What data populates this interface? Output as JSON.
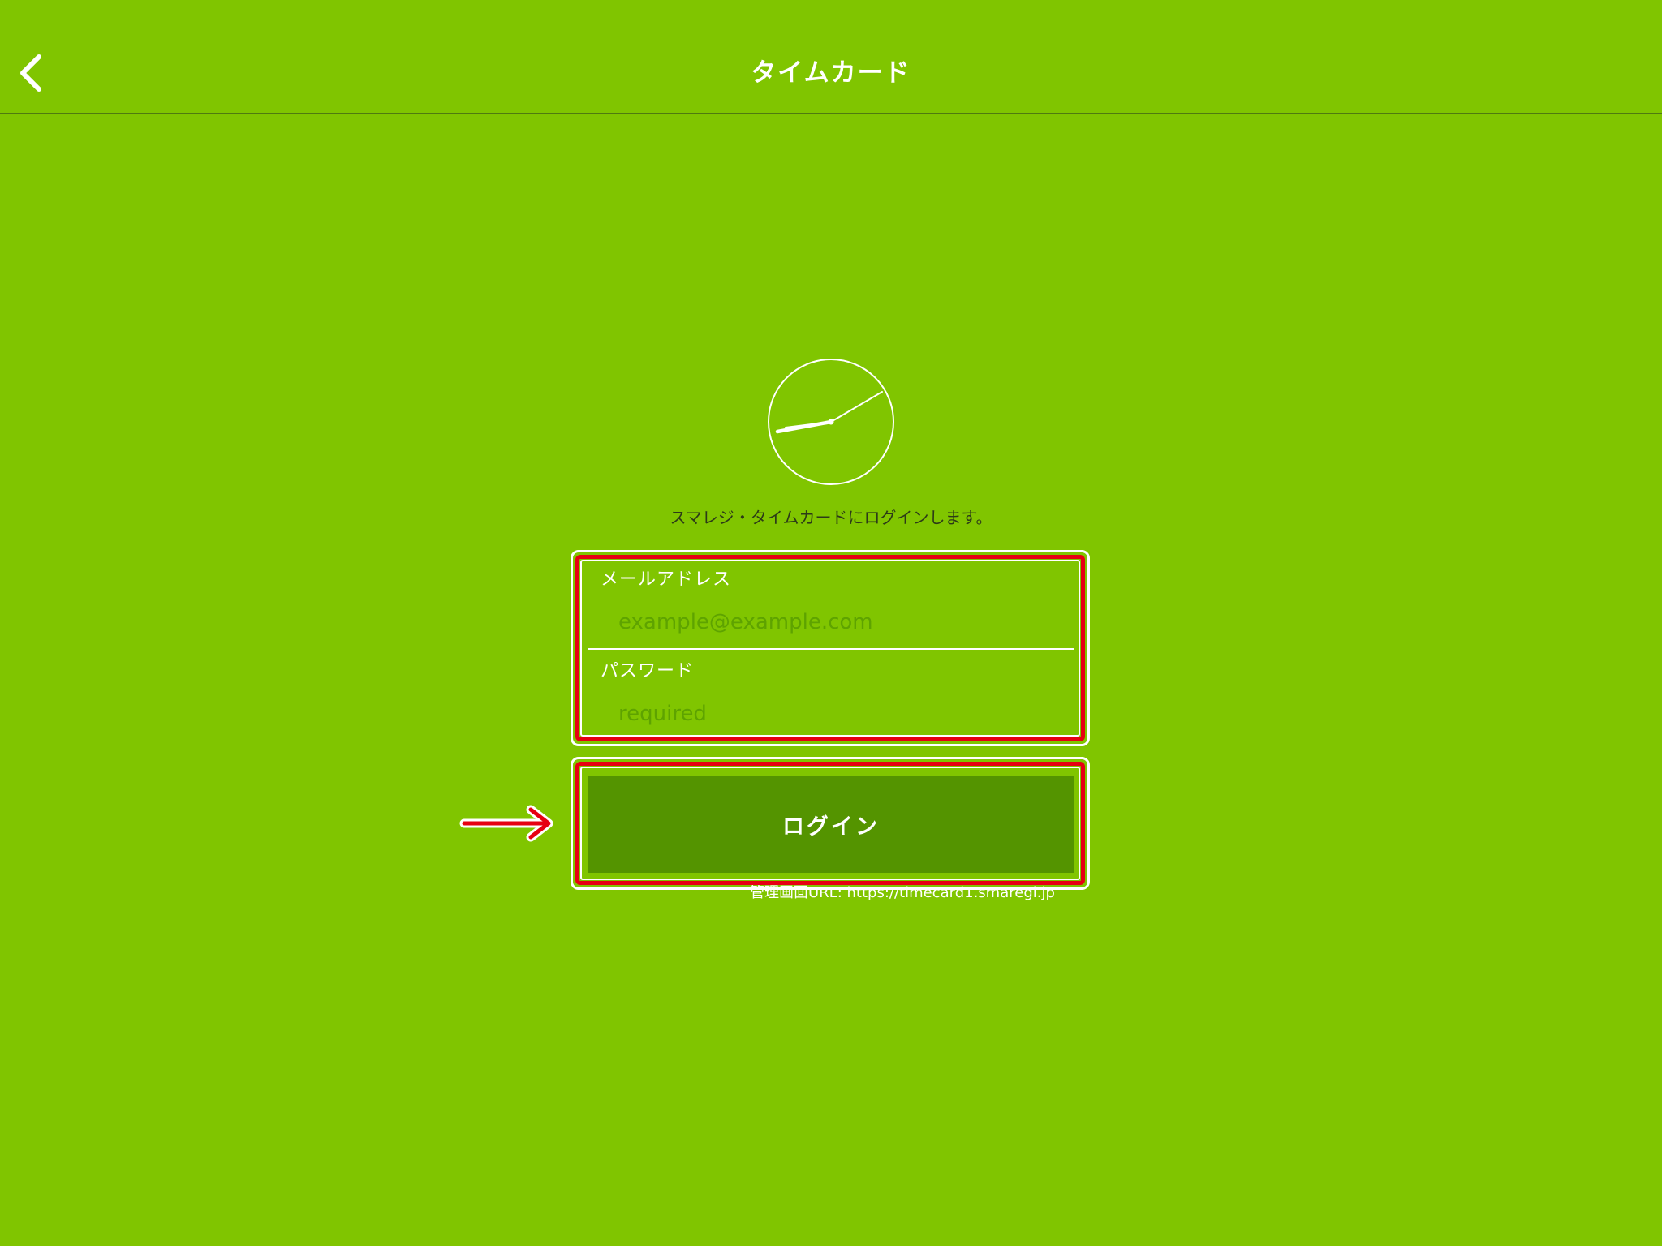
{
  "nav": {
    "title": "タイムカード",
    "back_icon": "chevron-left-icon"
  },
  "clock": {
    "icon": "clock-icon"
  },
  "login": {
    "intro": "スマレジ・タイムカードにログインします。",
    "email": {
      "label": "メールアドレス",
      "placeholder": "example@example.com",
      "value": ""
    },
    "password": {
      "label": "パスワード",
      "placeholder": "required",
      "value": ""
    },
    "button_label": "ログイン",
    "admin_url": "管理画面URL: https://timecard1.smaregi.jp"
  },
  "annotation": {
    "arrow_icon": "arrow-right-icon"
  },
  "colors": {
    "background": "#80c500",
    "button": "#549400",
    "placeholder": "#5ea300",
    "highlight": "#e60012",
    "text_dark": "#2c3a18"
  }
}
